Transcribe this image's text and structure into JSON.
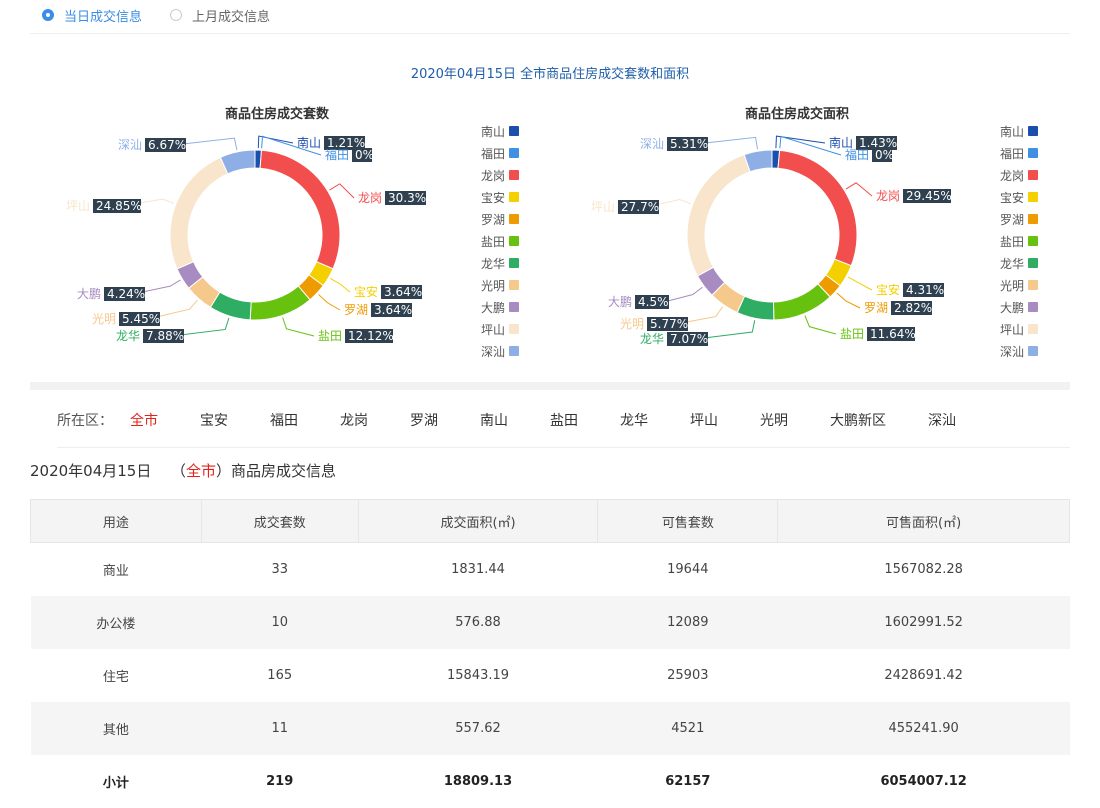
{
  "radios": [
    {
      "label": "当日成交信息",
      "selected": true
    },
    {
      "label": "上月成交信息",
      "selected": false
    }
  ],
  "main_title": "2020年04月15日 全市商品住房成交套数和面积",
  "chart_data": [
    {
      "type": "pie",
      "title": "商品住房成交套数",
      "categories": [
        "南山",
        "福田",
        "龙岗",
        "宝安",
        "罗湖",
        "盐田",
        "龙华",
        "光明",
        "大鹏",
        "坪山",
        "深汕"
      ],
      "values": [
        1.21,
        0,
        30.3,
        3.64,
        3.64,
        12.12,
        7.88,
        5.45,
        4.24,
        24.85,
        6.67
      ],
      "value_labels": [
        "1.21%",
        "0%",
        "30.3%",
        "3.64%",
        "3.64%",
        "12.12%",
        "7.88%",
        "5.45%",
        "4.24%",
        "24.85%",
        "6.67%"
      ],
      "colors": [
        "#1c4fad",
        "#3f8fe3",
        "#f24e4e",
        "#f4d000",
        "#ee9b00",
        "#66c20e",
        "#2fad63",
        "#f5c98c",
        "#a88bc1",
        "#f8e5cb",
        "#8eaee6"
      ],
      "legend": "right"
    },
    {
      "type": "pie",
      "title": "商品住房成交面积",
      "categories": [
        "南山",
        "福田",
        "龙岗",
        "宝安",
        "罗湖",
        "盐田",
        "龙华",
        "光明",
        "大鹏",
        "坪山",
        "深汕"
      ],
      "values": [
        1.43,
        0,
        29.45,
        4.31,
        2.82,
        11.64,
        7.07,
        5.77,
        4.5,
        27.7,
        5.31
      ],
      "value_labels": [
        "1.43%",
        "0%",
        "29.45%",
        "4.31%",
        "2.82%",
        "11.64%",
        "7.07%",
        "5.77%",
        "4.5%",
        "27.7%",
        "5.31%"
      ],
      "colors": [
        "#1c4fad",
        "#3f8fe3",
        "#f24e4e",
        "#f4d000",
        "#ee9b00",
        "#66c20e",
        "#2fad63",
        "#f5c98c",
        "#a88bc1",
        "#f8e5cb",
        "#8eaee6"
      ],
      "legend": "right"
    }
  ],
  "district_filter": {
    "label": "所在区：",
    "tabs": [
      "全市",
      "宝安",
      "福田",
      "龙岗",
      "罗湖",
      "南山",
      "盐田",
      "龙华",
      "坪山",
      "光明",
      "大鹏新区",
      "深汕"
    ],
    "active": "全市"
  },
  "sub_title": {
    "date": "2020年04月15日",
    "open": "（",
    "district": "全市",
    "close": "）商品房成交信息"
  },
  "table": {
    "headers": [
      "用途",
      "成交套数",
      "成交面积(㎡)",
      "可售套数",
      "可售面积(㎡)"
    ],
    "rows": [
      [
        "商业",
        "33",
        "1831.44",
        "19644",
        "1567082.28"
      ],
      [
        "办公楼",
        "10",
        "576.88",
        "12089",
        "1602991.52"
      ],
      [
        "住宅",
        "165",
        "15843.19",
        "25903",
        "2428691.42"
      ],
      [
        "其他",
        "11",
        "557.62",
        "4521",
        "455241.90"
      ]
    ],
    "total": [
      "小计",
      "219",
      "18809.13",
      "62157",
      "6054007.12"
    ]
  }
}
